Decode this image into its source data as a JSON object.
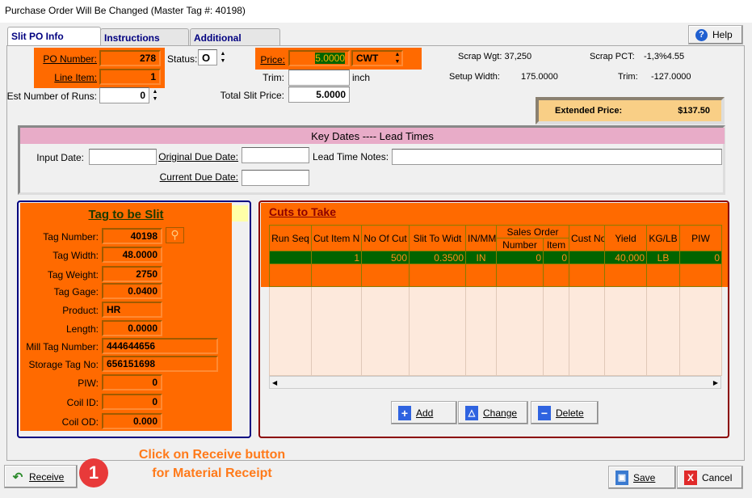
{
  "window": {
    "title": "Purchase Order Will Be Changed  (Master Tag #: 40198)"
  },
  "tabs": [
    {
      "label": "Slit PO Info"
    },
    {
      "label": "Instructions"
    },
    {
      "label": "Additional Charges"
    }
  ],
  "help_label": "Help",
  "po": {
    "po_number_label": "PO Number:",
    "po_number": "278",
    "line_item_label": "Line Item:",
    "line_item": "1",
    "runs_label": "Est Number of Runs:",
    "runs": "0",
    "status_label": "Status:",
    "status": "O",
    "price_label": "Price:",
    "price": "5.0000",
    "price_unit": "CWT",
    "trim_label": "Trim:",
    "trim": "",
    "trim_unit": "inch",
    "total_label": "Total Slit Price:",
    "total": "5.0000"
  },
  "stats": {
    "scrap_wgt_label": "Scrap Wgt:",
    "scrap_wgt": "37,250",
    "scrap_pct_label": "Scrap PCT:",
    "scrap_pct": "-1,3%4.55",
    "setup_label": "Setup Width:",
    "setup": "175.0000",
    "trim_label": "Trim:",
    "trim": "-127.0000",
    "ext_label": "Extended Price:",
    "ext": "$137.50"
  },
  "dates": {
    "header": "Key Dates ---- Lead Times",
    "input_label": "Input Date:",
    "input": "",
    "orig_label": "Original Due Date:",
    "orig": "",
    "current_label": "Current Due Date:",
    "current": "",
    "notes_label": "Lead Time Notes:",
    "notes": ""
  },
  "tag": {
    "title": "Tag to be Slit",
    "fields": [
      {
        "label": "Tag Number:",
        "value": "40198",
        "align": "right"
      },
      {
        "label": "Tag Width:",
        "value": "48.0000",
        "align": "right"
      },
      {
        "label": "Tag Weight:",
        "value": "2750",
        "align": "right"
      },
      {
        "label": "Tag Gage:",
        "value": "0.0400",
        "align": "right"
      },
      {
        "label": "Product:",
        "value": "HR",
        "align": "left"
      },
      {
        "label": "Length:",
        "value": "0.0000",
        "align": "right"
      },
      {
        "label": "Mill Tag Number:",
        "value": "444644656",
        "align": "left"
      },
      {
        "label": "Storage Tag No:",
        "value": "656151698",
        "align": "left"
      },
      {
        "label": "PIW:",
        "value": "0",
        "align": "right"
      },
      {
        "label": "Coil ID:",
        "value": "0",
        "align": "right"
      },
      {
        "label": "Coil OD:",
        "value": "0.000",
        "align": "right"
      }
    ]
  },
  "cuts": {
    "title": "Cuts to Take",
    "group_header": "Sales Order",
    "columns": [
      "Run Seq",
      "Cut Item N",
      "No Of Cut",
      "Slit To Widt",
      "IN/MM",
      "Number",
      "Item",
      "Cust No",
      "Yield",
      "KG/LB",
      "PIW"
    ],
    "rows": [
      [
        "",
        "1",
        "500",
        "0.3500",
        "IN",
        "0",
        "0",
        "",
        "40,000",
        "LB",
        "0"
      ]
    ]
  },
  "buttons": {
    "add": "Add",
    "change": "Change",
    "delete": "Delete",
    "receive": "Receive",
    "save": "Save",
    "cancel": "Cancel"
  },
  "annotation": {
    "step": "1",
    "text_line1": "Click on Receive button",
    "text_line2": "for Material Receipt"
  },
  "colors": {
    "highlight": "#ff6a00",
    "selected_row": "#006400",
    "ext_price_bg": "#f9cf86",
    "date_header": "#e8acc8"
  }
}
